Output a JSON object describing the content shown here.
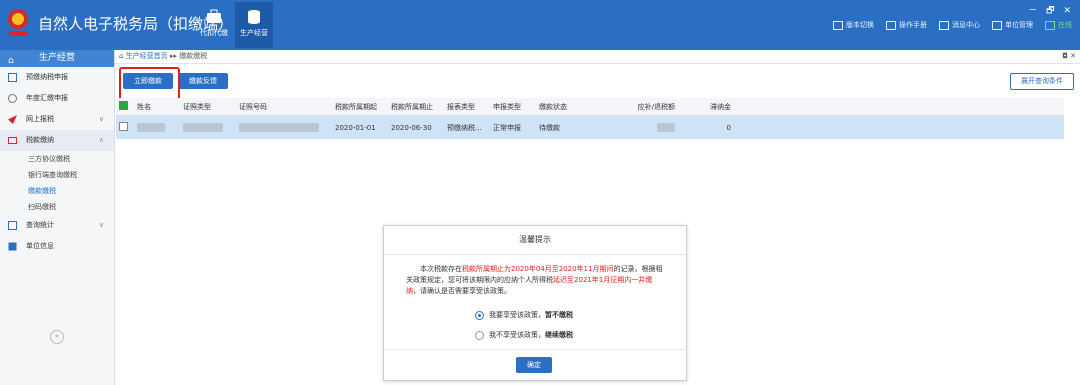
{
  "app": {
    "title": "自然人电子税务局（扣缴端）",
    "modules": [
      {
        "label": "代扣代缴",
        "icon": "briefcase-icon"
      },
      {
        "label": "生产经营",
        "icon": "database-icon"
      }
    ],
    "top_menu": [
      "版本切换",
      "操作手册",
      "消息中心",
      "单位管理",
      "在线"
    ],
    "window_controls": "－ 🗗 ✕"
  },
  "sidebar": {
    "header": "生产经营",
    "items": [
      {
        "label": "预缴纳税申报",
        "icon": "form-icon"
      },
      {
        "label": "年度汇缴申报",
        "icon": "clock-icon"
      },
      {
        "label": "网上报税",
        "icon": "send-icon",
        "chevron": "∨"
      },
      {
        "label": "税款缴纳",
        "icon": "money-icon",
        "chevron": "∧"
      },
      {
        "label": "查询统计",
        "icon": "chart-icon",
        "chevron": "∨"
      },
      {
        "label": "单位信息",
        "icon": "building-icon"
      }
    ],
    "sub_items": [
      "三方协议缴税",
      "银行端查询缴税",
      "缴款缴税",
      "扫码缴税"
    ],
    "collapse": "«"
  },
  "breadcrumb": {
    "home": "生产经营首页",
    "sep": "▸▸",
    "current": "缴款缴税",
    "controls": "◘ ✕"
  },
  "toolbar": {
    "pay_now": "立即缴款",
    "feedback": "缴款反馈",
    "expand_query": "展开查询条件"
  },
  "table": {
    "headers": [
      "姓名",
      "证照类型",
      "证照号码",
      "税款所属期起",
      "税款所属期止",
      "报表类型",
      "申报类型",
      "缴款状态",
      "应补/退税额",
      "滞纳金"
    ],
    "row": {
      "period_start": "2020-01-01",
      "period_end": "2020-06-30",
      "report_type": "预缴纳税...",
      "declare_type": "正常申报",
      "status": "待缴款",
      "late_fee": "0"
    }
  },
  "dialog": {
    "title": "温馨提示",
    "msg_1": "本次税款存在",
    "msg_red_1": "税款所属期止为2020年04月至2020年11月期间",
    "msg_2": "的记录，根据相关政策规定，您可将该期限内的应纳个人所得税",
    "msg_red_2": "延迟至2021年1月征期内一并缴纳",
    "msg_3": "，请确认是否需要享受该政策。",
    "option_1a": "我要享受该政策，",
    "option_1b": "暂不缴税",
    "option_2a": "我不享受该政策，",
    "option_2b": "继续缴税",
    "confirm": "确定"
  },
  "colors": {
    "primary": "#2b6fc4",
    "highlight_red": "#e02020",
    "selected_row": "#cfe3f6"
  }
}
